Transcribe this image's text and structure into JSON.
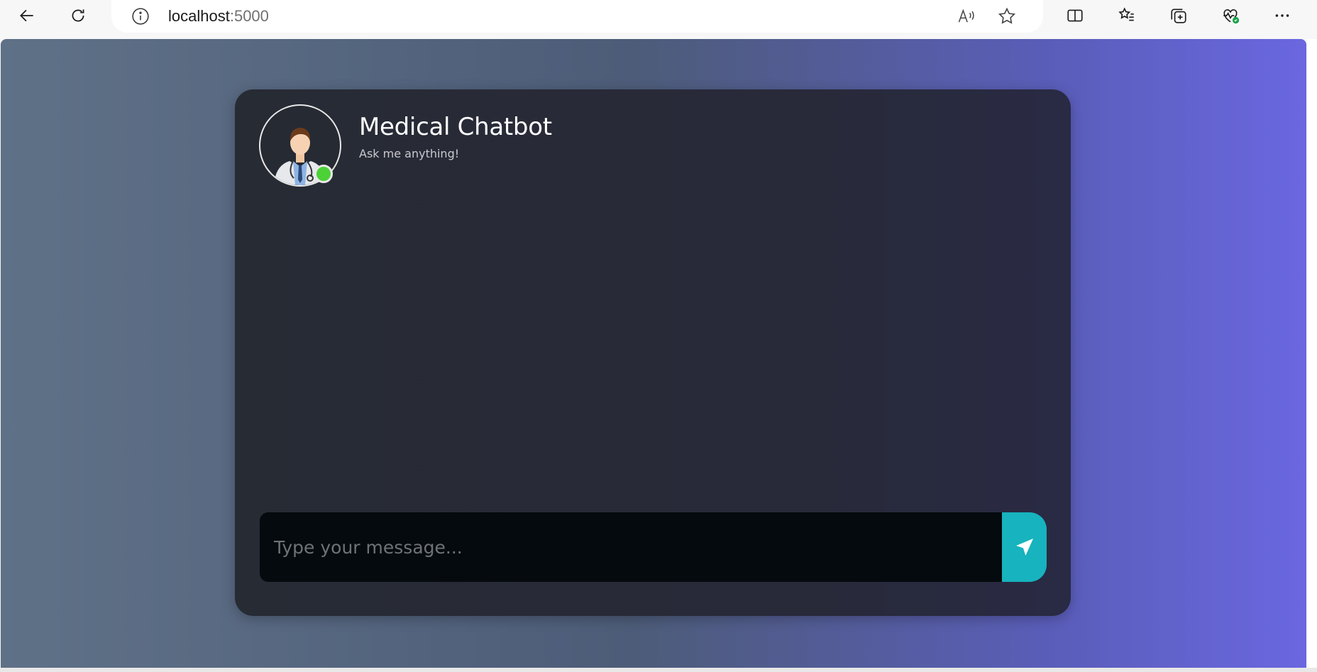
{
  "browser": {
    "url_host": "localhost",
    "url_port": ":5000",
    "icons": {
      "back": "back-arrow-icon",
      "refresh": "refresh-icon",
      "info": "info-icon",
      "read_aloud": "read-aloud-icon",
      "favorite": "star-icon",
      "split_screen": "split-screen-icon",
      "favorites": "favorites-list-icon",
      "collections": "collections-icon",
      "health": "browser-essentials-icon",
      "more": "more-icon"
    }
  },
  "chat": {
    "title": "Medical Chatbot",
    "subtitle": "Ask me anything!",
    "status": "online",
    "input_placeholder": "Type your message...",
    "colors": {
      "online": "#4cd137",
      "send_button": "#17b3be"
    }
  }
}
